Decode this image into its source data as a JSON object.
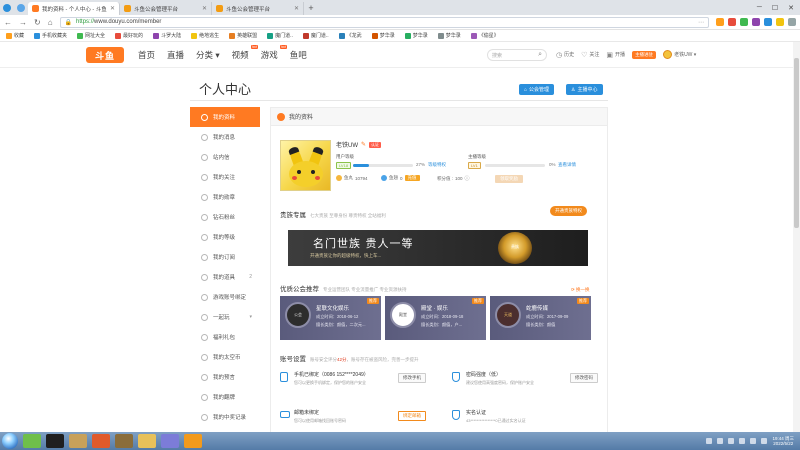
{
  "browser": {
    "tabs": [
      {
        "title": "我的资料 - 个人中心 - 斗鱼",
        "active": true,
        "fav_color": "#ff7a22"
      },
      {
        "title": "斗鱼公会管理平台",
        "active": false,
        "fav_color": "#f39c12"
      },
      {
        "title": "斗鱼公会管理平台",
        "active": false,
        "fav_color": "#f39c12"
      }
    ],
    "new_tab": "+",
    "url_scheme": "https://",
    "url_rest": "www.douyu.com/member",
    "bookmarks": [
      "收藏",
      "手机收藏夹",
      "网址大全",
      "最好玩的",
      "斗罗大陆",
      "绝地逃生",
      "英雄联盟",
      "魔门道..",
      "魔门道..",
      "《龙武",
      "梦华录",
      "梦华录",
      "梦华录",
      "《偷星》"
    ]
  },
  "site": {
    "logo_text": "斗鱼",
    "nav": [
      {
        "label": "首页",
        "hot": false
      },
      {
        "label": "直播",
        "hot": false
      },
      {
        "label": "分类 ▾",
        "hot": false
      },
      {
        "label": "视频",
        "hot": true
      },
      {
        "label": "游戏",
        "hot": true
      },
      {
        "label": "鱼吧",
        "hot": false
      }
    ],
    "hot_tag": "hot",
    "search_placeholder": "搜索",
    "header_actions": [
      "历史",
      "关注",
      "开播"
    ],
    "open_live": "主播进驻",
    "username_short": "老铁UW ▾"
  },
  "page": {
    "title": "个人中心",
    "guild_manage_btn": "公会管理",
    "anchor_center_btn": "主播中心"
  },
  "sidebar": {
    "items": [
      {
        "label": "我的资料",
        "active": true
      },
      {
        "label": "我的消息",
        "active": false
      },
      {
        "label": "站内信",
        "active": false
      },
      {
        "label": "我的关注",
        "active": false
      },
      {
        "label": "我的勋章",
        "active": false
      },
      {
        "label": "钻石粉丝",
        "active": false
      },
      {
        "label": "我的等级",
        "active": false
      },
      {
        "label": "我的订阅",
        "active": false
      },
      {
        "label": "我的道具",
        "active": false,
        "caret": "2"
      },
      {
        "label": "游戏账号绑定",
        "active": false
      },
      {
        "label": "一起玩",
        "active": false,
        "caret": "▾"
      },
      {
        "label": "福利礼包",
        "active": false
      },
      {
        "label": "我的太空币",
        "active": false
      },
      {
        "label": "我的预言",
        "active": false
      },
      {
        "label": "我的翻牌",
        "active": false
      },
      {
        "label": "我的中奖记录",
        "active": false
      }
    ]
  },
  "profile": {
    "panel_title": "我的资料",
    "username": "老铁UW",
    "badge": "认证",
    "user_level_label": "用户等级",
    "user_level_badge": "LV18",
    "user_level_pct": 27,
    "user_level_pct_text": "27%",
    "user_level_link": "等级特权",
    "anchor_level_label": "主播等级",
    "anchor_level_badge": "LV1",
    "anchor_level_pct": 0,
    "anchor_level_pct_text": "0%",
    "anchor_level_link": "查看详情",
    "yuwan_label": "鱼丸",
    "yuwan_value": "10794",
    "yuchi_label": "鱼翅",
    "yuchi_value": "0",
    "recharge_label": "充值",
    "score_label": "积分值 : ",
    "score_value": "100",
    "claim_btn": "领取奖励"
  },
  "noble": {
    "title": "贵族专属",
    "subtitle": "七大贵族 至尊身份 尊贵特权 全站福利",
    "open_btn": "开通贵族特权",
    "banner_main": "名门世族 贵人一等",
    "banner_sub": "开通贵族让你的超级特权，快上车...",
    "emblem_text": "贵族"
  },
  "guilds": {
    "title": "优质公会推荐",
    "subtitle_prefix": "专业运营团队 专业流量推广 专业资源扶持",
    "swap": "换一换",
    "rec_tag": "推荐",
    "items": [
      {
        "logo": "公会",
        "name": "星联文化娱乐",
        "founded": "成立时间：2018-06-12",
        "tags": "擅长类别：颜值，二次元...",
        "logo_style": ""
      },
      {
        "logo": "殿堂",
        "name": "殿堂 · 娱乐",
        "founded": "成立时间：2018-09-18",
        "tags": "擅长类别：颜值，户...",
        "logo_style": "white"
      },
      {
        "logo": "天道",
        "name": "蛇鹿传媒",
        "founded": "成立时间：2017-09-09",
        "tags": "擅长类别：颜值",
        "logo_style": "dark"
      }
    ]
  },
  "account": {
    "title": "账号设置",
    "security_prefix": "账号安全评分",
    "security_score": "42分",
    "security_note": "，账号存在被盗风险，完善一步提升",
    "phone_title": "手机已绑定（0086 152****2049）",
    "phone_desc": "您可以更换手机绑定，保护您的账户安全",
    "phone_btn": "修改手机",
    "pwd_title": "密码强度（低）",
    "pwd_desc": "建议您使用高强度密码，保护账户安全",
    "pwd_btn": "修改密码",
    "mail_title": "邮箱未绑定",
    "mail_desc": "您可以使用邮箱找回账号密码",
    "mail_btn": "绑定邮箱",
    "realname_title": "实名认证",
    "realname_desc": "43****************0已通过实名认证"
  },
  "taskbar": {
    "time": "19:44 周三",
    "date": "2022/5/22"
  },
  "colors": {
    "accent": "#ff7a22",
    "blue": "#2a8fdc"
  }
}
